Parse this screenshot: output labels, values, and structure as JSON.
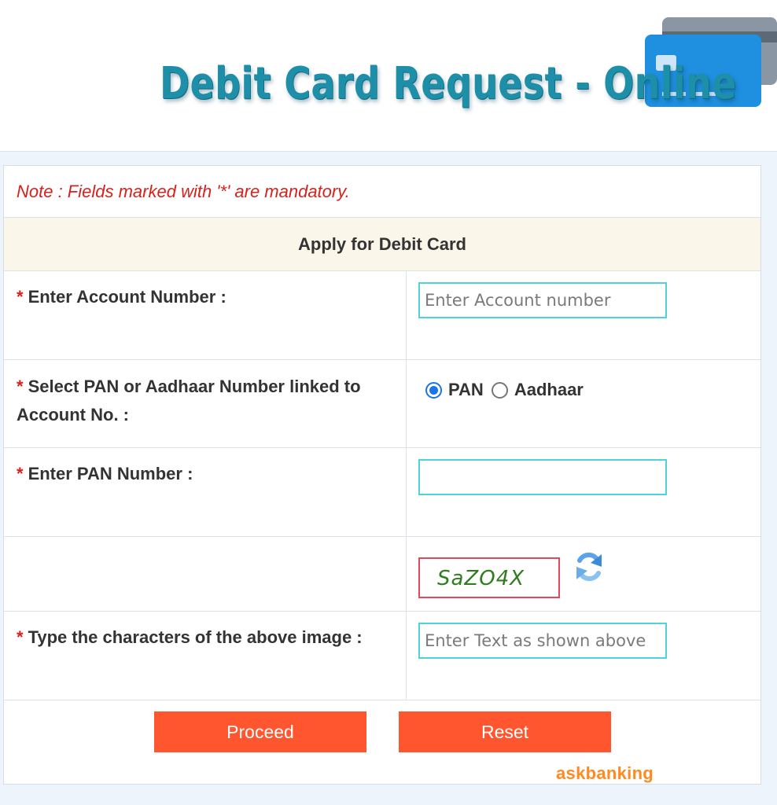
{
  "banner": {
    "title": "Debit Card Request - Online",
    "icon": "credit-card-icon"
  },
  "form": {
    "note": "Note : Fields marked with '*' are mandatory.",
    "heading": "Apply for Debit Card",
    "required_marker": "*",
    "account_label": "Enter Account Number :",
    "account_placeholder": "Enter Account number",
    "account_value": "",
    "linked_label": "Select PAN or Aadhaar Number linked to Account No. :",
    "options": [
      {
        "label": "PAN",
        "selected": true
      },
      {
        "label": "Aadhaar",
        "selected": false
      }
    ],
    "pan_label": "Enter PAN Number :",
    "pan_value": "",
    "captcha_text": "SaZO4X",
    "refresh_icon": "refresh-icon",
    "captcha_label": "Type the characters of the above image :",
    "captcha_placeholder": "Enter Text as shown above",
    "proceed_label": "Proceed",
    "reset_label": "Reset"
  },
  "watermark": "askbanking",
  "colors": {
    "title": "#1e8fa8",
    "required": "#d9211c",
    "button": "#ff5630",
    "input_border": "#4fd3d6",
    "captcha_border": "#e04a5a",
    "header_bg": "#fbf6ea",
    "watermark": "#ff8a1f"
  }
}
